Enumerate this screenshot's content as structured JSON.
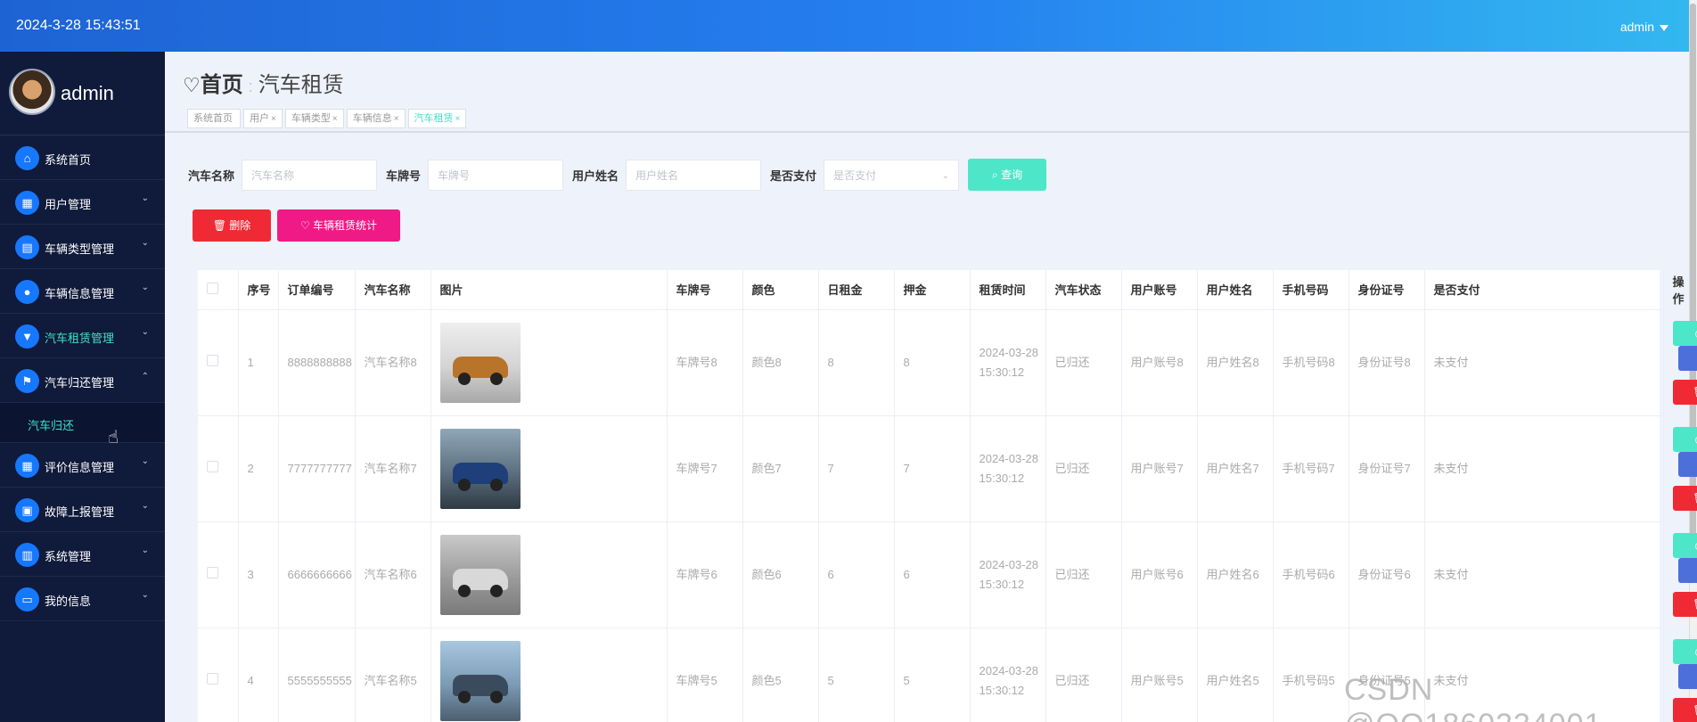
{
  "topbar": {
    "datetime": "2024-3-28 15:43:51",
    "user": "admin"
  },
  "sidebar": {
    "profile_name": "admin",
    "items": [
      {
        "label": "系统首页",
        "icon": "home-icon",
        "glyph": "⌂",
        "arrow": ""
      },
      {
        "label": "用户管理",
        "icon": "grid-icon",
        "glyph": "▦",
        "arrow": "⌄"
      },
      {
        "label": "车辆类型管理",
        "icon": "chart-icon",
        "glyph": "▤",
        "arrow": "⌄"
      },
      {
        "label": "车辆信息管理",
        "icon": "location-icon",
        "glyph": "●",
        "arrow": "⌄"
      },
      {
        "label": "汽车租赁管理",
        "icon": "cup-icon",
        "glyph": "▼",
        "arrow": "⌄"
      },
      {
        "label": "汽车归还管理",
        "icon": "flag-icon",
        "glyph": "⚑",
        "arrow": "⌃"
      },
      {
        "label": "评价信息管理",
        "icon": "grid-icon",
        "glyph": "▦",
        "arrow": "⌄"
      },
      {
        "label": "故障上报管理",
        "icon": "briefcase-icon",
        "glyph": "▣",
        "arrow": "⌄"
      },
      {
        "label": "系统管理",
        "icon": "clipboard-icon",
        "glyph": "▥",
        "arrow": "⌄"
      },
      {
        "label": "我的信息",
        "icon": "card-icon",
        "glyph": "▭",
        "arrow": "⌄"
      }
    ],
    "submenu": {
      "label": "汽车归还"
    }
  },
  "breadcrumb": {
    "home": "首页",
    "current": "汽车租赁"
  },
  "tags": [
    {
      "label": "系统首页",
      "close": ""
    },
    {
      "label": "用户",
      "close": "×"
    },
    {
      "label": "车辆类型",
      "close": "×"
    },
    {
      "label": "车辆信息",
      "close": "×"
    },
    {
      "label": "汽车租赁",
      "close": "×"
    }
  ],
  "search": {
    "car_name_label": "汽车名称",
    "car_name_placeholder": "汽车名称",
    "plate_label": "车牌号",
    "plate_placeholder": "车牌号",
    "username_label": "用户姓名",
    "username_placeholder": "用户姓名",
    "paid_label": "是否支付",
    "paid_placeholder": "是否支付",
    "query_label": "查询"
  },
  "actions": {
    "delete_label": "删除",
    "stat_label": "车辆租赁统计"
  },
  "table": {
    "headers": [
      "序号",
      "订单编号",
      "汽车名称",
      "图片",
      "车牌号",
      "颜色",
      "日租金",
      "押金",
      "租赁时间",
      "汽车状态",
      "用户账号",
      "用户姓名",
      "手机号码",
      "身份证号",
      "是否支付",
      "操作"
    ],
    "rows": [
      {
        "no": "1",
        "order": "8888888888",
        "name": "汽车名称8",
        "plate": "车牌号8",
        "color": "颜色8",
        "rent": "8",
        "deposit": "8",
        "time": "2024-03-28 15:30:12",
        "status": "已归还",
        "account": "用户账号8",
        "uname": "用户姓名8",
        "phone": "手机号码8",
        "idcard": "身份证号8",
        "paid": "未支付"
      },
      {
        "no": "2",
        "order": "7777777777",
        "name": "汽车名称7",
        "plate": "车牌号7",
        "color": "颜色7",
        "rent": "7",
        "deposit": "7",
        "time": "2024-03-28 15:30:12",
        "status": "已归还",
        "account": "用户账号7",
        "uname": "用户姓名7",
        "phone": "手机号码7",
        "idcard": "身份证号7",
        "paid": "未支付"
      },
      {
        "no": "3",
        "order": "6666666666",
        "name": "汽车名称6",
        "plate": "车牌号6",
        "color": "颜色6",
        "rent": "6",
        "deposit": "6",
        "time": "2024-03-28 15:30:12",
        "status": "已归还",
        "account": "用户账号6",
        "uname": "用户姓名6",
        "phone": "手机号码6",
        "idcard": "身份证号6",
        "paid": "未支付"
      },
      {
        "no": "4",
        "order": "5555555555",
        "name": "汽车名称5",
        "plate": "车牌号5",
        "color": "颜色5",
        "rent": "5",
        "deposit": "5",
        "time": "2024-03-28 15:30:12",
        "status": "已归还",
        "account": "用户账号5",
        "uname": "用户姓名5",
        "phone": "手机号码5",
        "idcard": "身份证号5",
        "paid": "未支付"
      }
    ],
    "op_view": "查看",
    "op_edit": "修改",
    "op_delete": "删除"
  },
  "colors": {
    "accent": "#4ee6c8",
    "danger": "#f02a35",
    "edit": "#4d6fd9",
    "pink": "#f01a86",
    "sidebar": "#101a3a"
  },
  "watermark": "CSDN @QQ1860234001"
}
